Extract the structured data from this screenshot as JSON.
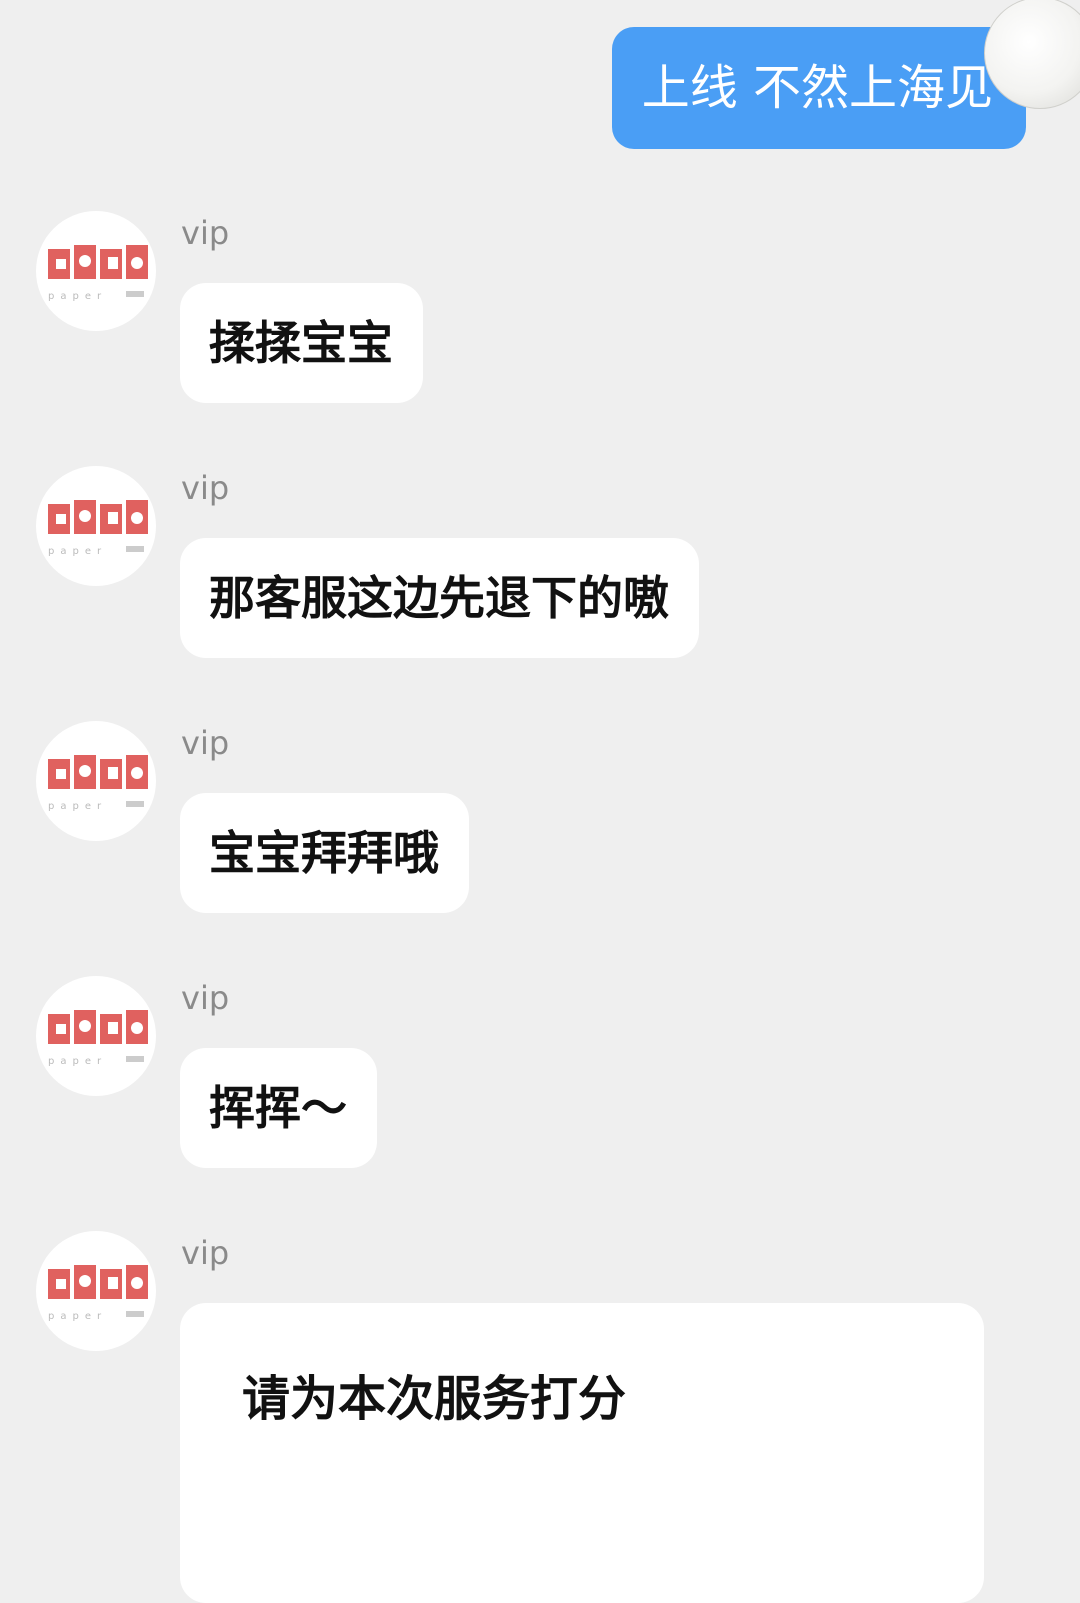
{
  "outgoing": {
    "text": "上线 不然上海见"
  },
  "messages": [
    {
      "sender": "vip",
      "text": "揉揉宝宝",
      "avatar_icon": "paper-logo-icon"
    },
    {
      "sender": "vip",
      "text": "那客服这边先退下的嗷",
      "avatar_icon": "paper-logo-icon"
    },
    {
      "sender": "vip",
      "text": "宝宝拜拜哦",
      "avatar_icon": "paper-logo-icon"
    },
    {
      "sender": "vip",
      "text": "挥挥～",
      "avatar_icon": "paper-logo-icon"
    }
  ],
  "rating_card": {
    "sender": "vip",
    "title": "请为本次服务打分"
  },
  "colors": {
    "background": "#efefef",
    "outgoing_bubble": "#4a9ef5",
    "logo_red": "#e0615f"
  }
}
